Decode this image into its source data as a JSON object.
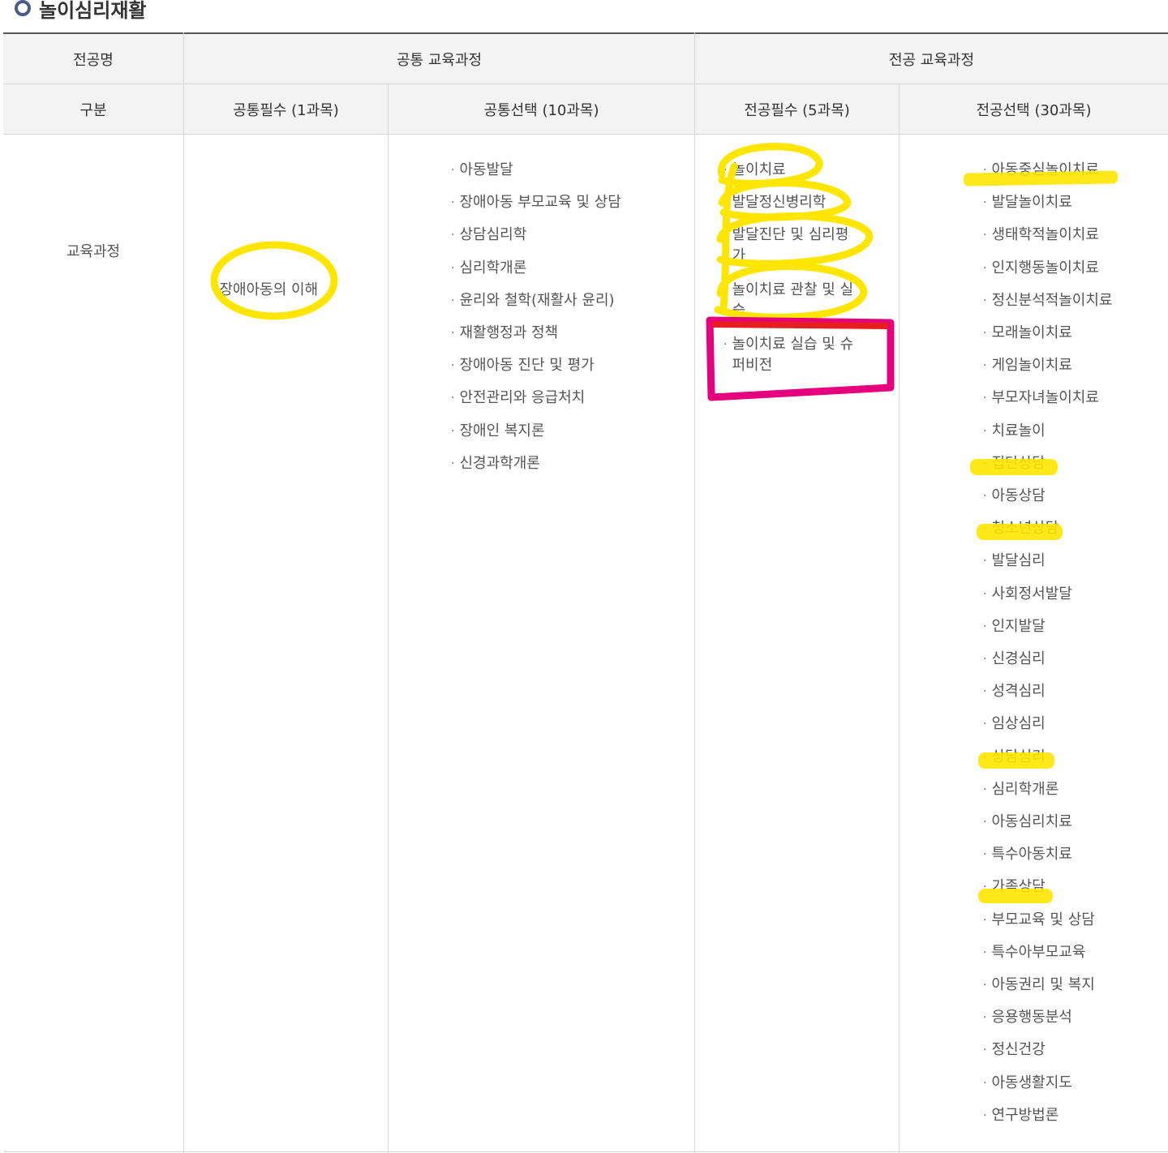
{
  "section_title": "놀이심리재활",
  "header": {
    "major_name": "전공명",
    "common_curriculum": "공통 교육과정",
    "major_curriculum": "전공 교육과정",
    "category": "구분",
    "common_required": "공통필수 (1과목)",
    "common_elective": "공통선택 (10과목)",
    "major_required": "전공필수 (5과목)",
    "major_elective": "전공선택 (30과목)"
  },
  "row_label": "교육과정",
  "bullet": "·",
  "common_required_items": [
    "장애아동의 이해"
  ],
  "common_elective_items": [
    "아동발달",
    "장애아동 부모교육 및 상담",
    "상담심리학",
    "심리학개론",
    "윤리와 철학(재활사 윤리)",
    "재활행정과 정책",
    "장애아동 진단 및 평가",
    "안전관리와 응급처치",
    "장애인 복지론",
    "신경과학개론"
  ],
  "major_required_items": [
    "놀이치료",
    "발달정신병리학",
    "발달진단 및 심리평가",
    "놀이치료 관찰 및 실습",
    "놀이치료 실습 및 슈퍼비전"
  ],
  "major_elective_items": [
    "아동중심놀이치료",
    "발달놀이치료",
    "생태학적놀이치료",
    "인지행동놀이치료",
    "정신분석적놀이치료",
    "모래놀이치료",
    "게임놀이치료",
    "부모자녀놀이치료",
    "치료놀이",
    "집단상담",
    "아동상담",
    "청소년상담",
    "발달심리",
    "사회정서발달",
    "인지발달",
    "신경심리",
    "성격심리",
    "임상심리",
    "상담심리",
    "심리학개론",
    "아동심리치료",
    "특수아동치료",
    "가족상담",
    "부모교육 및 상담",
    "특수아부모교육",
    "아동권리 및 복지",
    "응용행동분석",
    "정신건강",
    "아동생활지도",
    "연구방법론"
  ],
  "colors": {
    "highlight_yellow": "#ffe600",
    "highlight_magenta": "#e6007e",
    "title_bullet": "#4a5a8c"
  }
}
